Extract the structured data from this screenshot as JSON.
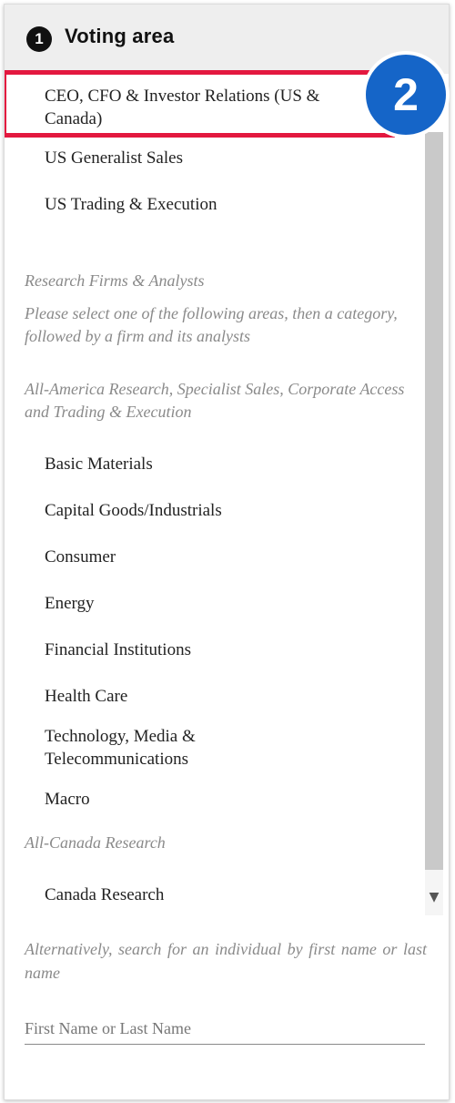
{
  "header": {
    "step_number": "1",
    "title": "Voting area"
  },
  "badge": {
    "number": "2"
  },
  "top_items": [
    "CEO, CFO & Investor Relations (US & Canada)",
    "US Generalist Sales",
    "US Trading & Execution"
  ],
  "research": {
    "heading": "Research Firms & Analysts",
    "instructions": "Please select one of the following areas, then a category, followed by a firm and its analysts",
    "group1_heading": "All-America Research, Specialist Sales, Corporate Access and Trading & Execution",
    "group1_items": [
      "Basic Materials",
      "Capital Goods/Industrials",
      "Consumer",
      "Energy",
      "Financial Institutions",
      "Health Care",
      "Technology, Media & Telecommunications",
      "Macro"
    ],
    "group2_heading": "All-Canada Research",
    "group2_items": [
      "Canada Research"
    ]
  },
  "search": {
    "alt_text": "Alternatively, search for an individual by first name or last name",
    "placeholder": "First Name or Last Name"
  },
  "colors": {
    "highlight": "#e3183f",
    "badge": "#1565c8",
    "header_bg": "#eeeeee"
  }
}
